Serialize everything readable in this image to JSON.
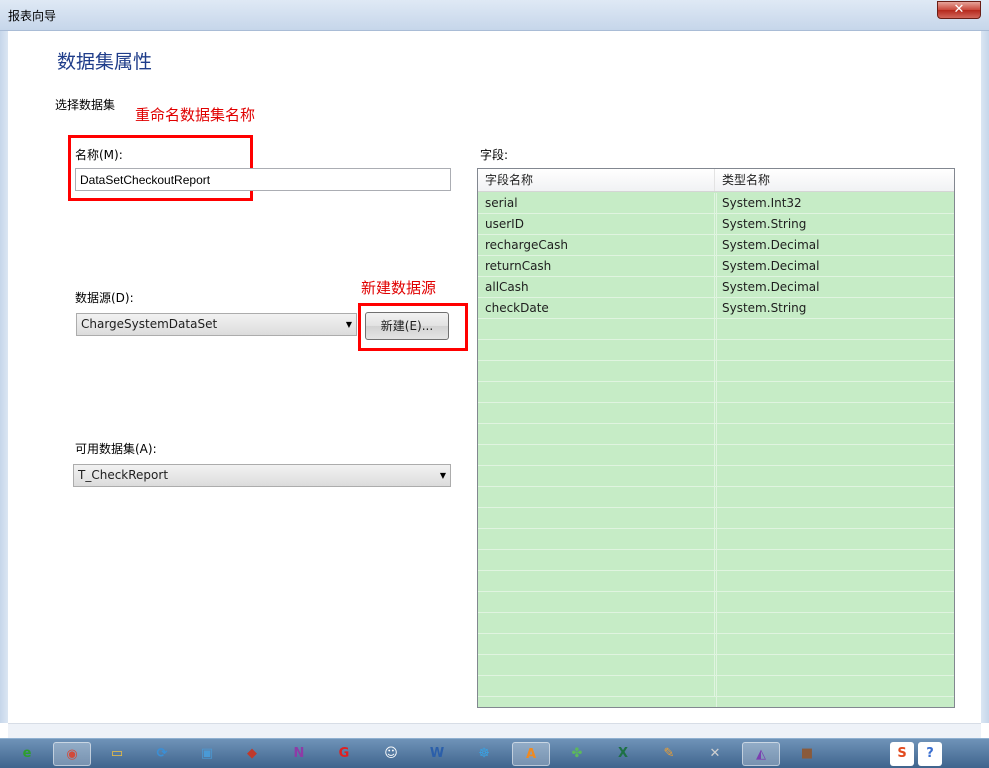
{
  "window": {
    "title": "报表向导",
    "close_glyph": "✕"
  },
  "dialog": {
    "heading": "数据集属性",
    "section_label": "选择数据集"
  },
  "annotations": {
    "rename": "重命名数据集名称",
    "new_source": "新建数据源"
  },
  "name_field": {
    "label": "名称(M):",
    "value": "DataSetCheckoutReport"
  },
  "datasource": {
    "label": "数据源(D):",
    "selected": "ChargeSystemDataSet",
    "new_button": "新建(E)..."
  },
  "available": {
    "label": "可用数据集(A):",
    "selected": "T_CheckReport"
  },
  "fields": {
    "label": "字段:",
    "columns": [
      "字段名称",
      "类型名称"
    ],
    "rows": [
      [
        "serial",
        "System.Int32"
      ],
      [
        "userID",
        "System.String"
      ],
      [
        "rechargeCash",
        "System.Decimal"
      ],
      [
        "returnCash",
        "System.Decimal"
      ],
      [
        "allCash",
        "System.Decimal"
      ],
      [
        "checkDate",
        "System.String"
      ]
    ]
  },
  "taskbar": {
    "items": [
      {
        "name": "ie-icon",
        "glyph": "e",
        "color": "#2e9e2e"
      },
      {
        "name": "chrome-icon",
        "glyph": "◉",
        "color": "#d24a3a"
      },
      {
        "name": "explorer-icon",
        "glyph": "▭",
        "color": "#f0c040"
      },
      {
        "name": "network-icon",
        "glyph": "⟳",
        "color": "#3a8fd6"
      },
      {
        "name": "remote-desktop-icon",
        "glyph": "▣",
        "color": "#4a9ad6"
      },
      {
        "name": "xmind-icon",
        "glyph": "◆",
        "color": "#c0392b"
      },
      {
        "name": "onenote-icon",
        "glyph": "N",
        "color": "#8e3ba6"
      },
      {
        "name": "app-g-icon",
        "glyph": "G",
        "color": "#e02020"
      },
      {
        "name": "qq-icon",
        "glyph": "☺",
        "color": "#ffffff"
      },
      {
        "name": "word-icon",
        "glyph": "W",
        "color": "#2b5faa"
      },
      {
        "name": "browser-icon",
        "glyph": "☸",
        "color": "#3aa0e0"
      },
      {
        "name": "app-a-icon",
        "glyph": "A",
        "color": "#f08a20"
      },
      {
        "name": "clover-icon",
        "glyph": "✤",
        "color": "#5cb85c"
      },
      {
        "name": "excel-icon",
        "glyph": "X",
        "color": "#1e7145"
      },
      {
        "name": "paint-icon",
        "glyph": "✎",
        "color": "#f0a030"
      },
      {
        "name": "tools-icon",
        "glyph": "✕",
        "color": "#d0d0d0"
      },
      {
        "name": "visual-studio-icon",
        "glyph": "◭",
        "color": "#7b3fb0"
      },
      {
        "name": "photo-icon",
        "glyph": "■",
        "color": "#8a5a3a"
      }
    ],
    "tray": [
      {
        "name": "sogou-icon",
        "glyph": "S",
        "color": "#e24a1e"
      },
      {
        "name": "help-icon",
        "glyph": "?",
        "color": "#3a6fd0"
      }
    ]
  }
}
